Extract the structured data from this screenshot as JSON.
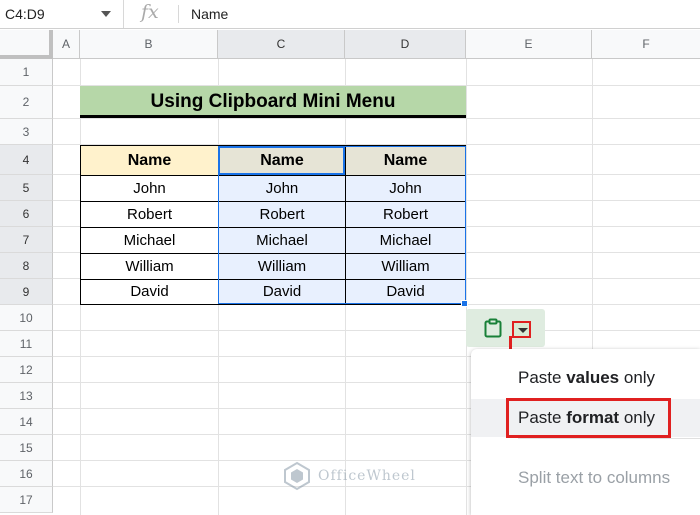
{
  "formula_bar": {
    "name_box": "C4:D9",
    "fx_label": "fx",
    "value": "Name"
  },
  "columns": [
    "A",
    "B",
    "C",
    "D",
    "E",
    "F"
  ],
  "selected_columns": [
    "C",
    "D"
  ],
  "rows": [
    "1",
    "2",
    "3",
    "4",
    "5",
    "6",
    "7",
    "8",
    "9",
    "10",
    "11",
    "12",
    "13",
    "14",
    "15",
    "16",
    "17"
  ],
  "selected_rows": [
    "4",
    "5",
    "6",
    "7",
    "8",
    "9"
  ],
  "sheet": {
    "title": "Using Clipboard Mini Menu",
    "header": [
      "Name",
      "Name",
      "Name"
    ],
    "names": [
      "John",
      "Robert",
      "Michael",
      "William",
      "David"
    ]
  },
  "paste_menu": {
    "items": [
      {
        "prefix": "Paste ",
        "bold": "values",
        "suffix": " only"
      },
      {
        "prefix": "Paste ",
        "bold": "format",
        "suffix": " only"
      }
    ],
    "disabled_item": "Split text to columns"
  },
  "icons": {
    "clipboard": "clipboard-icon",
    "dropdown": "chevron-down-icon"
  },
  "colors": {
    "title_bg": "#b6d7a8",
    "header_b_bg": "#fff2cc",
    "header_cd_bg": "#e6e4d6",
    "selection_blue": "#1a73e8",
    "annotation_red": "#e02020"
  },
  "watermark": "OfficeWheel"
}
